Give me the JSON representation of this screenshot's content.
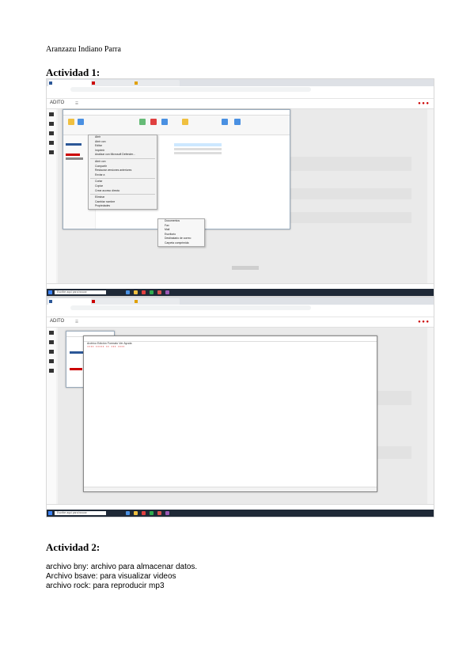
{
  "document": {
    "author": "Aranzazu Indiano Parra",
    "activity1_heading": "Actividad 1:",
    "activity2_heading": "Actividad 2:",
    "answers": [
      "archivo bny: archivo para almacenar datos.",
      "Archivo bsave: para visualizar videos",
      "archivo rock: para reproducir mp3"
    ]
  },
  "screenshot1": {
    "app_logo": "ADITO",
    "context_menu_items": [
      "Abrir",
      "Abrir con",
      "Editar",
      "Imprimir",
      "Analizar con Microsoft Defender...",
      "Abrir con",
      "Compartir",
      "Restaurar versiones anteriores",
      "Enviar a",
      "Cortar",
      "Copiar",
      "Crear acceso directo",
      "Eliminar",
      "Cambiar nombre",
      "Propiedades"
    ],
    "submenu_items": [
      "Documentos",
      "Fax",
      "Mail",
      "Escritorio",
      "Destinatario de correo",
      "Carpeta comprimida"
    ]
  },
  "screenshot2": {
    "app_logo": "ADITO",
    "notepad_menu": "Archivo  Edición  Formato  Ver  Ayuda",
    "taskbar_search": "Escribe aquí para buscar"
  }
}
